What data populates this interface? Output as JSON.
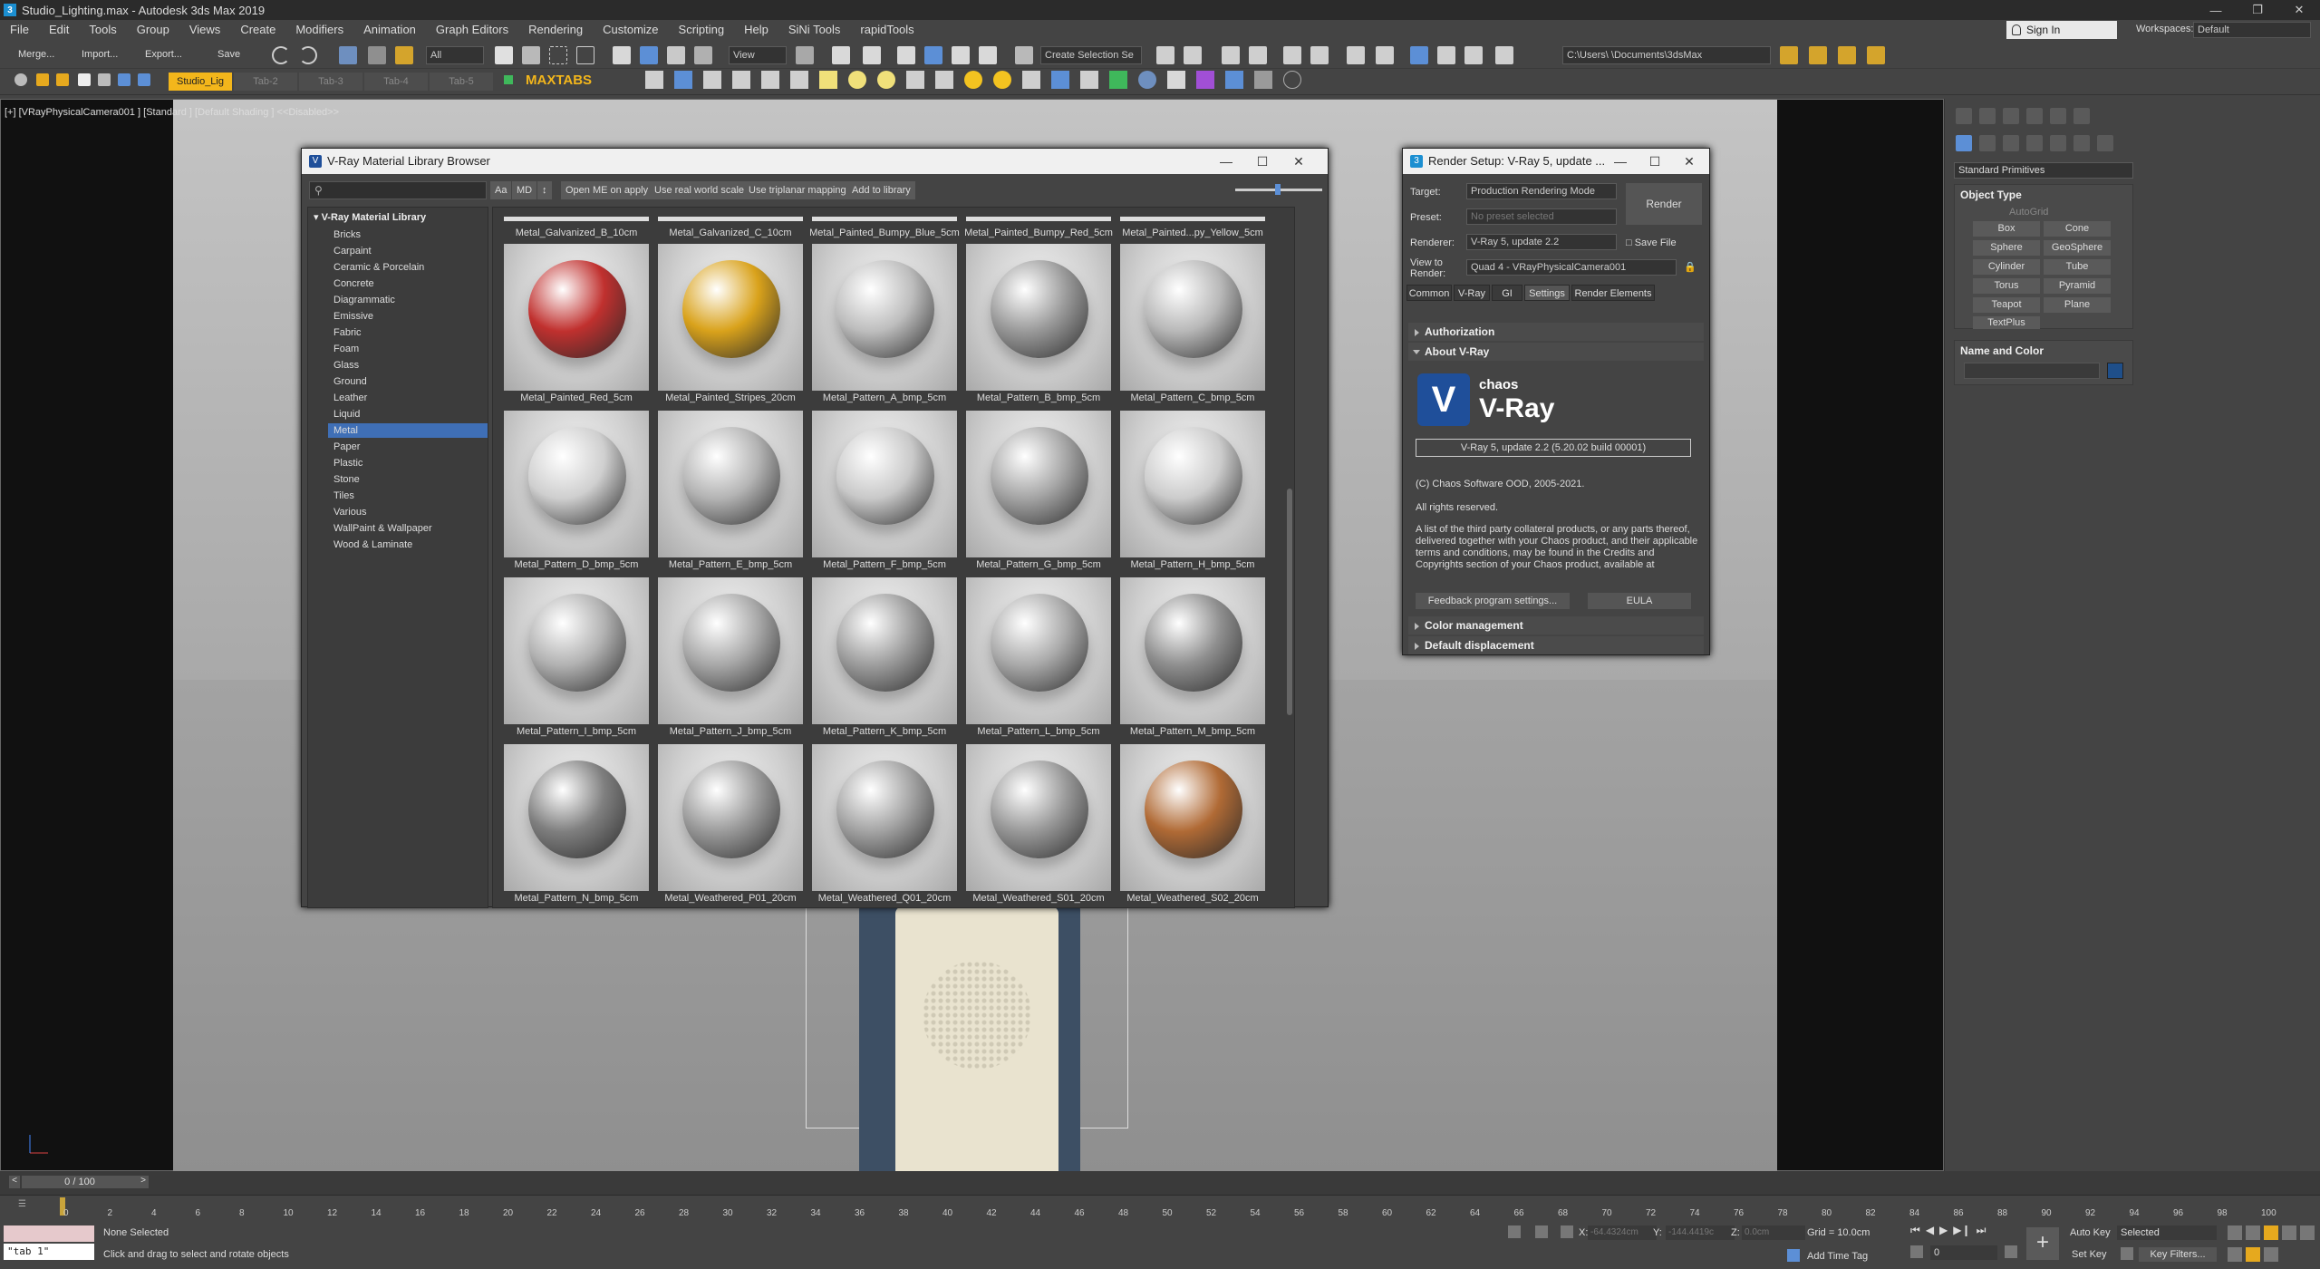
{
  "window": {
    "title": "Studio_Lighting.max - Autodesk 3ds Max 2019"
  },
  "menu": [
    "File",
    "Edit",
    "Tools",
    "Group",
    "Views",
    "Create",
    "Modifiers",
    "Animation",
    "Graph Editors",
    "Rendering",
    "Customize",
    "Scripting",
    "Help",
    "SiNi Tools",
    "rapidTools"
  ],
  "signin": "Sign In",
  "workspace": {
    "label": "Workspaces:",
    "value": "Default"
  },
  "toolbar": {
    "merge": "Merge...",
    "import": "Import...",
    "export": "Export...",
    "save": "Save",
    "filter": "All",
    "view": "View",
    "selection_set": "Create Selection Se",
    "path": "C:\\Users\\          \\Documents\\3dsMax"
  },
  "tabs": [
    "Studio_Lig",
    "Tab-2",
    "Tab-3",
    "Tab-4",
    "Tab-5"
  ],
  "maxtabs": "MAXTABS",
  "viewport": {
    "label": "[+] [VRayPhysicalCamera001 ] [Standard ] [Default Shading ]  <<Disabled>>"
  },
  "material_browser": {
    "title": "V-Ray Material Library Browser",
    "buttons": [
      "Aa",
      "MD",
      "↕",
      "Open ME on apply",
      "Use real world scale",
      "Use triplanar mapping",
      "Add to library"
    ],
    "root": "V-Ray Material Library",
    "categories": [
      "Bricks",
      "Carpaint",
      "Ceramic & Porcelain",
      "Concrete",
      "Diagrammatic",
      "Emissive",
      "Fabric",
      "Foam",
      "Glass",
      "Ground",
      "Leather",
      "Liquid",
      "Metal",
      "Paper",
      "Plastic",
      "Stone",
      "Tiles",
      "Various",
      "WallPaint & Wallpaper",
      "Wood & Laminate"
    ],
    "selected_category": "Metal",
    "top_row": [
      "Metal_Galvanized_B_10cm",
      "Metal_Galvanized_C_10cm",
      "Metal_Painted_Bumpy_Blue_5cm",
      "Metal_Painted_Bumpy_Red_5cm",
      "Metal_Painted...py_Yellow_5cm"
    ],
    "materials": [
      {
        "name": "Metal_Painted_Red_5cm",
        "color": "#c0302e"
      },
      {
        "name": "Metal_Painted_Stripes_20cm",
        "color": "#d9a21b"
      },
      {
        "name": "Metal_Pattern_A_bmp_5cm",
        "color": "#bdbdbd"
      },
      {
        "name": "Metal_Pattern_B_bmp_5cm",
        "color": "#9a9a9a"
      },
      {
        "name": "Metal_Pattern_C_bmp_5cm",
        "color": "#b8b8b8"
      },
      {
        "name": "Metal_Pattern_D_bmp_5cm",
        "color": "#cfcfcf"
      },
      {
        "name": "Metal_Pattern_E_bmp_5cm",
        "color": "#b4b4b4"
      },
      {
        "name": "Metal_Pattern_F_bmp_5cm",
        "color": "#c9c9c9"
      },
      {
        "name": "Metal_Pattern_G_bmp_5cm",
        "color": "#a5a5a5"
      },
      {
        "name": "Metal_Pattern_H_bmp_5cm",
        "color": "#cccccc"
      },
      {
        "name": "Metal_Pattern_I_bmp_5cm",
        "color": "#b2b2b2"
      },
      {
        "name": "Metal_Pattern_J_bmp_5cm",
        "color": "#a8a8a8"
      },
      {
        "name": "Metal_Pattern_K_bmp_5cm",
        "color": "#9e9e9e"
      },
      {
        "name": "Metal_Pattern_L_bmp_5cm",
        "color": "#aaaaaa"
      },
      {
        "name": "Metal_Pattern_M_bmp_5cm",
        "color": "#8f8f8f"
      },
      {
        "name": "Metal_Pattern_N_bmp_5cm",
        "color": "#7f7f7f"
      },
      {
        "name": "Metal_Weathered_P01_20cm",
        "color": "#9b9b9b"
      },
      {
        "name": "Metal_Weathered_Q01_20cm",
        "color": "#a3a3a3"
      },
      {
        "name": "Metal_Weathered_S01_20cm",
        "color": "#999999"
      },
      {
        "name": "Metal_Weathered_S02_20cm",
        "color": "#b06a35"
      }
    ]
  },
  "render_setup": {
    "title": "Render Setup: V-Ray 5, update ...",
    "target_label": "Target:",
    "target": "Production Rendering Mode",
    "preset_label": "Preset:",
    "preset": "No preset selected",
    "renderer_label": "Renderer:",
    "renderer": "V-Ray 5, update 2.2",
    "save_file": "Save File",
    "view_label": "View to Render:",
    "view": "Quad 4 - VRayPhysicalCamera001",
    "render_btn": "Render",
    "tabs": [
      "Common",
      "V-Ray",
      "GI",
      "Settings",
      "Render Elements"
    ],
    "active_tab": "Settings",
    "sections": {
      "auth": "Authorization",
      "about": "About V-Ray",
      "color": "Color management",
      "disp": "Default displacement"
    },
    "logo_brand": "chaos",
    "logo_product": "V-Ray",
    "version": "V-Ray 5, update 2.2 (5.20.02 build 00001)",
    "copyright": "(C) Chaos Software OOD, 2005-2021.",
    "rights": "All rights reserved.",
    "notice": "A list of the third party collateral products, or any parts thereof, delivered together with your Chaos product, and their applicable terms and conditions, may be found in the Credits and Copyrights section of your Chaos product, available at",
    "feedback": "Feedback program settings...",
    "eula": "EULA"
  },
  "command_panel": {
    "category": "Standard Primitives",
    "object_type": "Object Type",
    "autogrid": "AutoGrid",
    "primitives": [
      "Box",
      "Cone",
      "Sphere",
      "GeoSphere",
      "Cylinder",
      "Tube",
      "Torus",
      "Pyramid",
      "Teapot",
      "Plane",
      "TextPlus"
    ],
    "name_color": "Name and Color",
    "swatch": "#1f4f8a"
  },
  "timeline": {
    "frame": "0 / 100",
    "ticks": [
      "0",
      "2",
      "4",
      "6",
      "8",
      "10",
      "12",
      "14",
      "16",
      "18",
      "20",
      "22",
      "24",
      "26",
      "28",
      "30",
      "32",
      "34",
      "36",
      "38",
      "40",
      "42",
      "44",
      "46",
      "48",
      "50",
      "52",
      "54",
      "56",
      "58",
      "60",
      "62",
      "64",
      "66",
      "68",
      "70",
      "72",
      "74",
      "76",
      "78",
      "80",
      "82",
      "84",
      "86",
      "88",
      "90",
      "92",
      "94",
      "96",
      "98",
      "100"
    ]
  },
  "status": {
    "script": "\"tab 1\"",
    "selection": "None Selected",
    "prompt": "Click and drag to select and rotate objects",
    "x_label": "X:",
    "x": "-64.4324cm",
    "y_label": "Y:",
    "y": "-144.4419c",
    "z_label": "Z:",
    "z": "0.0cm",
    "grid": "Grid = 10.0cm",
    "add_time_tag": "Add Time Tag",
    "auto_key": "Auto Key",
    "set_key": "Set Key",
    "key_mode": "Selected",
    "key_filters": "Key Filters...",
    "frame_field": "0"
  }
}
